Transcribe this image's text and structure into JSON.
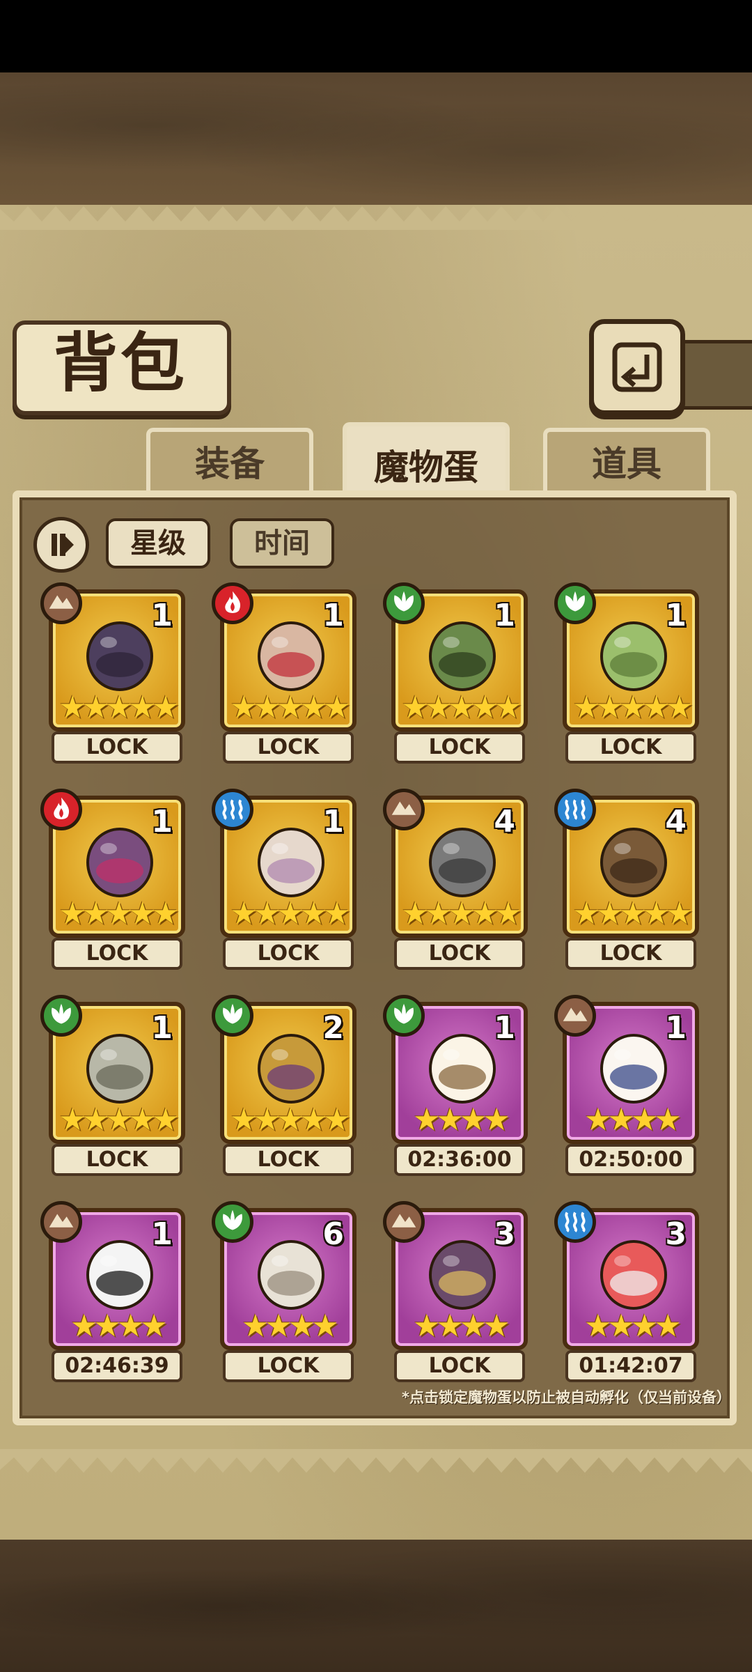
{
  "title": "背包",
  "tabs": [
    {
      "label": "装备",
      "active": false
    },
    {
      "label": "魔物蛋",
      "active": true
    },
    {
      "label": "道具",
      "active": false
    }
  ],
  "sort": {
    "star_label": "星级",
    "time_label": "时间",
    "selected": "星级"
  },
  "items": [
    {
      "element": "earth-icon",
      "count": "1",
      "stars": "★★★★★",
      "tier": "gold",
      "status": "LOCK",
      "art": "dark-rock-egg"
    },
    {
      "element": "fire-icon",
      "count": "1",
      "stars": "★★★★★",
      "tier": "gold",
      "status": "LOCK",
      "art": "red-swirl-egg"
    },
    {
      "element": "nature-icon",
      "count": "1",
      "stars": "★★★★★",
      "tier": "gold",
      "status": "LOCK",
      "art": "green-lantern"
    },
    {
      "element": "nature-icon",
      "count": "1",
      "stars": "★★★★★",
      "tier": "gold",
      "status": "LOCK",
      "art": "green-egg"
    },
    {
      "element": "fire-icon",
      "count": "1",
      "stars": "★★★★★",
      "tier": "gold",
      "status": "LOCK",
      "art": "purple-orb-egg"
    },
    {
      "element": "water-icon",
      "count": "1",
      "stars": "★★★★★",
      "tier": "gold",
      "status": "LOCK",
      "art": "winged-swirl-egg"
    },
    {
      "element": "earth-icon",
      "count": "4",
      "stars": "★★★★★",
      "tier": "gold",
      "status": "LOCK",
      "art": "broken-sword"
    },
    {
      "element": "water-icon",
      "count": "4",
      "stars": "★★★★★",
      "tier": "gold",
      "status": "LOCK",
      "art": "wooden-staff"
    },
    {
      "element": "nature-icon",
      "count": "1",
      "stars": "★★★★★",
      "tier": "gold",
      "status": "LOCK",
      "art": "pocket-watch"
    },
    {
      "element": "nature-icon",
      "count": "2",
      "stars": "★★★★★",
      "tier": "gold",
      "status": "LOCK",
      "art": "magic-lamp"
    },
    {
      "element": "nature-icon",
      "count": "1",
      "stars": "★★★★",
      "tier": "purple",
      "status": "02:36:00",
      "art": "white-nest-egg"
    },
    {
      "element": "earth-icon",
      "count": "1",
      "stars": "★★★★",
      "tier": "purple",
      "status": "02:50:00",
      "art": "white-wrapped-egg"
    },
    {
      "element": "earth-icon",
      "count": "1",
      "stars": "★★★★",
      "tier": "purple",
      "status": "02:46:39",
      "art": "striped-spider-egg"
    },
    {
      "element": "nature-icon",
      "count": "6",
      "stars": "★★★★",
      "tier": "purple",
      "status": "LOCK",
      "art": "tank-turret-egg"
    },
    {
      "element": "earth-icon",
      "count": "3",
      "stars": "★★★★",
      "tier": "purple",
      "status": "LOCK",
      "art": "snake-pot-egg"
    },
    {
      "element": "water-icon",
      "count": "3",
      "stars": "★★★★",
      "tier": "purple",
      "status": "01:42:07",
      "art": "feather-egg"
    }
  ],
  "footer_note": "*点击锁定魔物蛋以防止被自动孵化（仅当前设备）",
  "colors": {
    "gold_frame": "#d99a1c",
    "purple_frame": "#a13f9a",
    "earth": "#8c5f45",
    "fire": "#d8232a",
    "nature": "#3d9a3c",
    "water": "#2d86d2",
    "parchment": "#c9b98a"
  }
}
